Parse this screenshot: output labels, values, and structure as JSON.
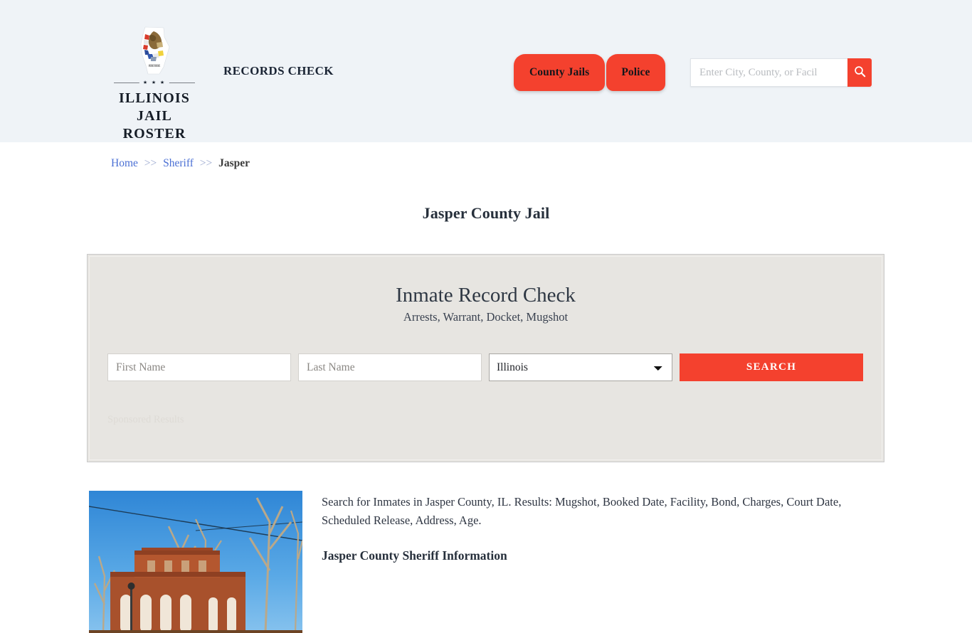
{
  "header": {
    "brand": {
      "line1": "ILLINOIS",
      "line2": "JAIL ROSTER",
      "emblem_dots": "★ ★ ★",
      "emblem_motto": "PUB. SEAL"
    },
    "tagline": "RECORDS CHECK",
    "nav": [
      {
        "label": "County Jails"
      },
      {
        "label": "Police"
      }
    ],
    "search": {
      "placeholder": "Enter City, County, or Facil",
      "value": "",
      "button_icon": "search-icon"
    },
    "background_color": "#eff3f7",
    "accent_color": "#f4412e"
  },
  "breadcrumb": {
    "items": [
      {
        "label": "Home",
        "link": true
      },
      {
        "label": "Sheriff",
        "link": true
      },
      {
        "label": "Jasper",
        "link": false
      }
    ],
    "separator": ">>"
  },
  "page": {
    "title": "Jasper County Jail"
  },
  "search_panel": {
    "heading": "Inmate Record Check",
    "subheading": "Arrests, Warrant, Docket, Mugshot",
    "first_name_placeholder": "First Name",
    "first_name_value": "",
    "last_name_placeholder": "Last Name",
    "last_name_value": "",
    "state_selected": "Illinois",
    "state_options": [
      "Illinois"
    ],
    "submit_label": "SEARCH",
    "sponsored_label": "Sponsored Results",
    "background_color": "#e7e5e1"
  },
  "content": {
    "image_alt": "jasper-county-courthouse-photo",
    "paragraph": "Search for Inmates in Jasper County, IL. Results: Mugshot, Booked Date, Facility, Bond, Charges, Court Date, Scheduled Release, Address, Age.",
    "subheading": "Jasper County Sheriff Information"
  }
}
